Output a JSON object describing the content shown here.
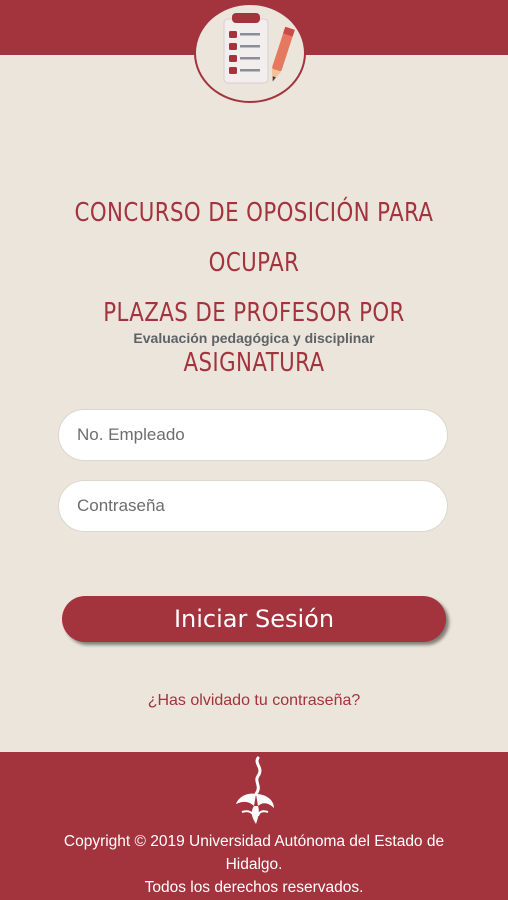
{
  "header": {
    "logo_icon": "checklist-pencil-icon"
  },
  "main": {
    "title_line1": "CONCURSO DE OPOSICIÓN PARA OCUPAR",
    "title_line2": "PLAZAS DE PROFESOR POR ASIGNATURA",
    "subtitle": "Evaluación pedagógica y disciplinar"
  },
  "form": {
    "employee_placeholder": "No. Empleado",
    "employee_value": "",
    "password_placeholder": "Contraseña",
    "password_value": "",
    "login_label": "Iniciar Sesión",
    "forgot_label": "¿Has olvidado tu contraseña?"
  },
  "footer": {
    "logo_icon": "university-garza-icon",
    "copyright_line1": "Copyright © 2019 Universidad Autónoma del Estado de",
    "copyright_line2": "Hidalgo.",
    "rights": "Todos los derechos reservados."
  },
  "colors": {
    "primary": "#a3333d",
    "background": "#ebe5dc"
  }
}
